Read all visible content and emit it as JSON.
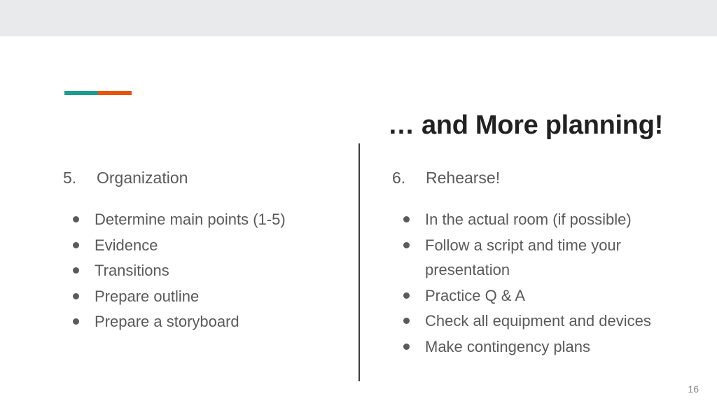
{
  "slide": {
    "page_number": "16",
    "title": "… and More planning!",
    "accent_bar": {
      "left_color": "#1c9e8e",
      "right_color": "#e8540c"
    },
    "colors": {
      "top_band": "#e8eaeb",
      "title_text": "#212121",
      "body_text": "#5a5a5a",
      "divider": "#3c3c3c",
      "background": "#ffffff"
    },
    "columns": [
      {
        "number": "5.",
        "heading": "Organization",
        "bullets": [
          "Determine main points (1-5)",
          "Evidence",
          "Transitions",
          "Prepare outline",
          "Prepare a storyboard"
        ]
      },
      {
        "number": "6.",
        "heading": "Rehearse!",
        "bullets": [
          "In the actual room (if possible)",
          "Follow a script and time your presentation",
          "Practice Q & A",
          "Check all equipment and devices",
          "Make contingency plans"
        ]
      }
    ]
  }
}
